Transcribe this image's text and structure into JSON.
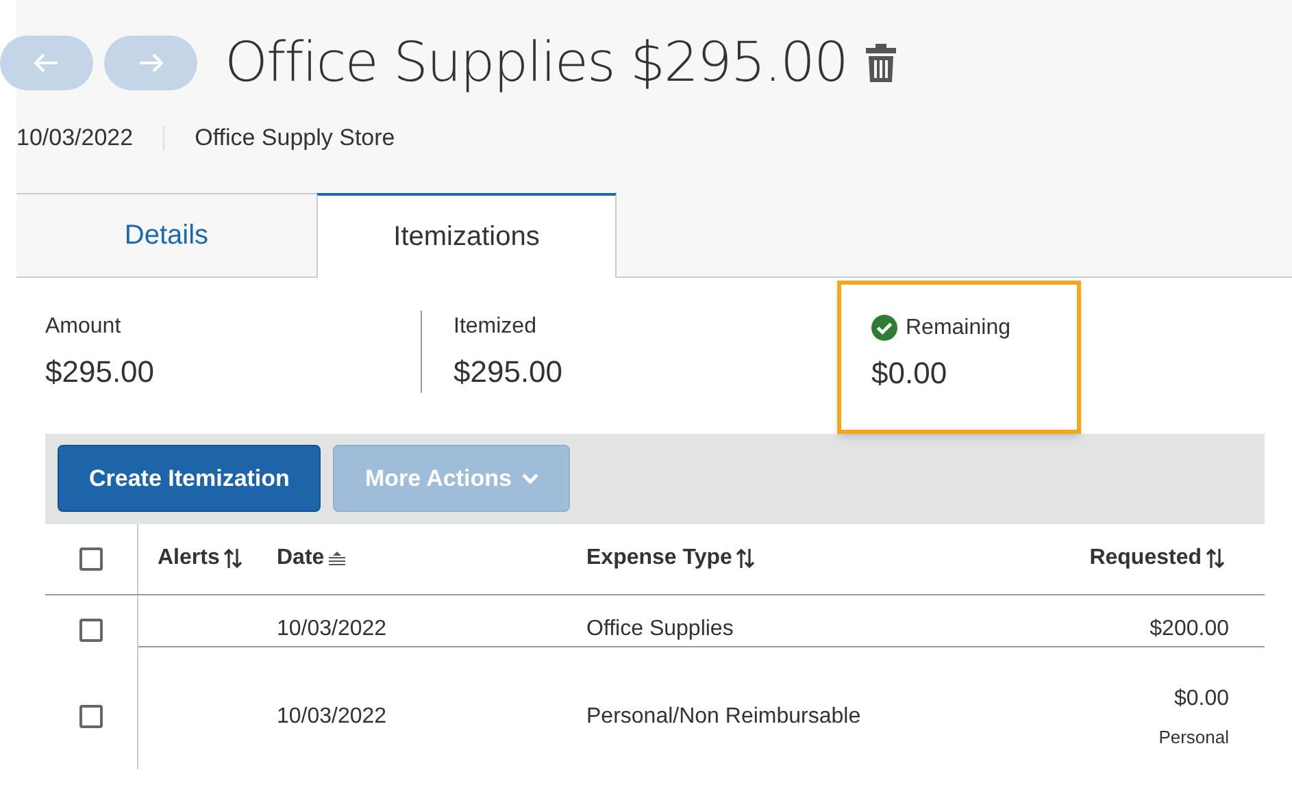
{
  "header": {
    "title": "Office Supplies $295.00",
    "date": "10/03/2022",
    "merchant": "Office Supply Store"
  },
  "nav_buttons": [
    {
      "kind": "back",
      "disabled": true
    },
    {
      "kind": "forward",
      "disabled": true
    }
  ],
  "tabs": [
    {
      "label": "Details",
      "selected": false
    },
    {
      "label": "Itemizations",
      "selected": true
    }
  ],
  "summary": [
    {
      "label": "Amount",
      "value": "$295.00",
      "highlighted": false,
      "ok": false
    },
    {
      "label": "Itemized",
      "value": "$295.00",
      "highlighted": false,
      "ok": false
    },
    {
      "label": "Remaining",
      "value": "$0.00",
      "highlighted": true,
      "ok": true
    }
  ],
  "toolbar": [
    {
      "label": "Create Itemization",
      "disabled": false,
      "menu": false
    },
    {
      "label": "More Actions",
      "disabled": true,
      "menu": true
    }
  ],
  "table": {
    "select_all": {
      "checked": false
    },
    "columns": [
      {
        "label": "Alerts",
        "kind": "sortable"
      },
      {
        "label": "Date",
        "kind": "sorted"
      },
      {
        "label": "Expense Type",
        "kind": "sortable"
      },
      {
        "label": "Requested",
        "kind": "sortable"
      }
    ],
    "rows": [
      {
        "checked": false,
        "date": "10/03/2022",
        "expense_type": "Office Supplies",
        "requested": "$200.00"
      },
      {
        "checked": false,
        "date": "10/03/2022",
        "expense_type": "Personal/Non Reimbursable",
        "requested": "$0.00",
        "requested_note": "Personal"
      }
    ]
  }
}
